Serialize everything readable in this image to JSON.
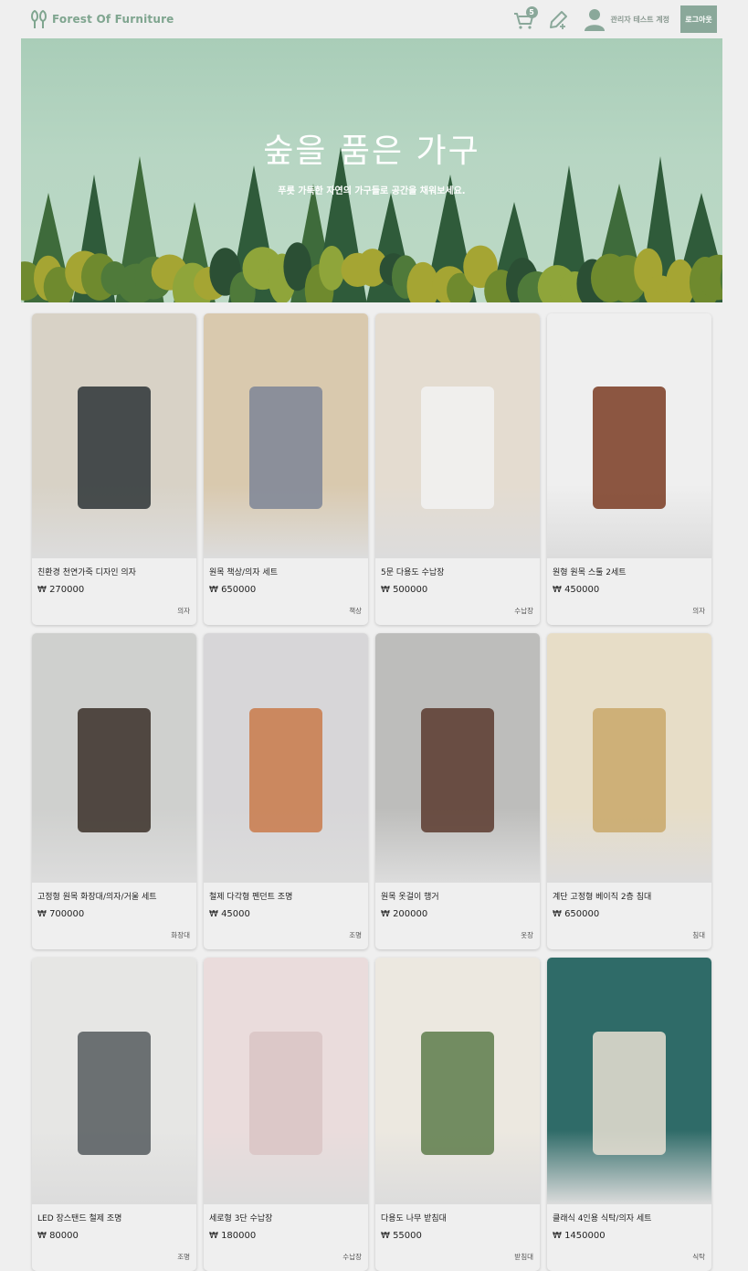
{
  "header": {
    "logo_text": "Forest Of Furniture",
    "cart_count": "5",
    "user_name": "관리자 테스트 계정",
    "logout_label": "로그아웃",
    "brand_color": "#8aa89a"
  },
  "hero": {
    "title": "숲을 품은 가구",
    "subtitle": "푸릇 가득한 자연의 가구들로 공간을 채워보세요."
  },
  "products": [
    {
      "name": "친환경 천연가죽 디자인 의자",
      "price": "₩ 270000",
      "category": "의자"
    },
    {
      "name": "원목 책상/의자 세트",
      "price": "₩ 650000",
      "category": "책상"
    },
    {
      "name": "5문 다용도 수납장",
      "price": "₩ 500000",
      "category": "수납장"
    },
    {
      "name": "원형 원목 스툴 2세트",
      "price": "₩ 450000",
      "category": "의자"
    },
    {
      "name": "고정형 원목 화장대/의자/거울 세트",
      "price": "₩ 700000",
      "category": "화장대"
    },
    {
      "name": "철제 다각형 펜던트 조명",
      "price": "₩ 45000",
      "category": "조명"
    },
    {
      "name": "원목 옷걸이 행거",
      "price": "₩ 200000",
      "category": "옷장"
    },
    {
      "name": "계단 고정형 베이직 2층 침대",
      "price": "₩ 650000",
      "category": "침대"
    },
    {
      "name": "LED 장스탠드 철제 조명",
      "price": "₩ 80000",
      "category": "조명"
    },
    {
      "name": "세로형 3단 수납장",
      "price": "₩ 180000",
      "category": "수납장"
    },
    {
      "name": "다용도 나무 받침대",
      "price": "₩ 55000",
      "category": "받침대"
    },
    {
      "name": "클래식 4인용 식탁/의자 세트",
      "price": "₩ 1450000",
      "category": "식탁"
    }
  ]
}
